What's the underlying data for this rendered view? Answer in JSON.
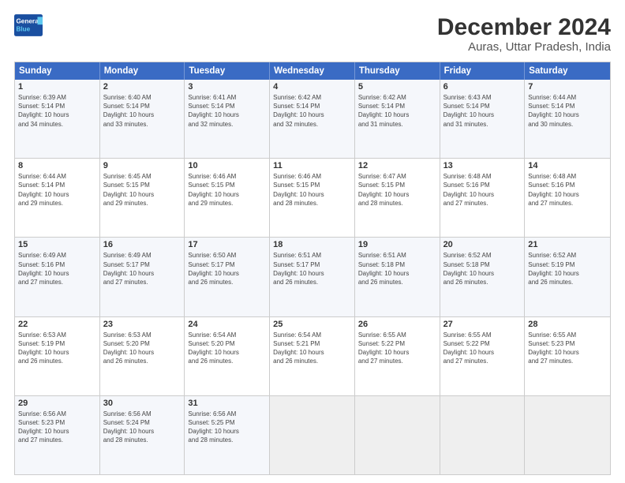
{
  "header": {
    "logo_line1": "General",
    "logo_line2": "Blue",
    "title": "December 2024",
    "subtitle": "Auras, Uttar Pradesh, India"
  },
  "calendar": {
    "days_of_week": [
      "Sunday",
      "Monday",
      "Tuesday",
      "Wednesday",
      "Thursday",
      "Friday",
      "Saturday"
    ],
    "weeks": [
      [
        {
          "day": "",
          "empty": true
        },
        {
          "day": "",
          "empty": true
        },
        {
          "day": "",
          "empty": true
        },
        {
          "day": "",
          "empty": true
        },
        {
          "day": "",
          "empty": true
        },
        {
          "day": "",
          "empty": true
        },
        {
          "day": "",
          "empty": true
        }
      ],
      [
        {
          "day": "1",
          "info": "Sunrise: 6:39 AM\nSunset: 5:14 PM\nDaylight: 10 hours\nand 34 minutes."
        },
        {
          "day": "2",
          "info": "Sunrise: 6:40 AM\nSunset: 5:14 PM\nDaylight: 10 hours\nand 33 minutes."
        },
        {
          "day": "3",
          "info": "Sunrise: 6:41 AM\nSunset: 5:14 PM\nDaylight: 10 hours\nand 32 minutes."
        },
        {
          "day": "4",
          "info": "Sunrise: 6:42 AM\nSunset: 5:14 PM\nDaylight: 10 hours\nand 32 minutes."
        },
        {
          "day": "5",
          "info": "Sunrise: 6:42 AM\nSunset: 5:14 PM\nDaylight: 10 hours\nand 31 minutes."
        },
        {
          "day": "6",
          "info": "Sunrise: 6:43 AM\nSunset: 5:14 PM\nDaylight: 10 hours\nand 31 minutes."
        },
        {
          "day": "7",
          "info": "Sunrise: 6:44 AM\nSunset: 5:14 PM\nDaylight: 10 hours\nand 30 minutes."
        }
      ],
      [
        {
          "day": "8",
          "info": "Sunrise: 6:44 AM\nSunset: 5:14 PM\nDaylight: 10 hours\nand 29 minutes."
        },
        {
          "day": "9",
          "info": "Sunrise: 6:45 AM\nSunset: 5:15 PM\nDaylight: 10 hours\nand 29 minutes."
        },
        {
          "day": "10",
          "info": "Sunrise: 6:46 AM\nSunset: 5:15 PM\nDaylight: 10 hours\nand 29 minutes."
        },
        {
          "day": "11",
          "info": "Sunrise: 6:46 AM\nSunset: 5:15 PM\nDaylight: 10 hours\nand 28 minutes."
        },
        {
          "day": "12",
          "info": "Sunrise: 6:47 AM\nSunset: 5:15 PM\nDaylight: 10 hours\nand 28 minutes."
        },
        {
          "day": "13",
          "info": "Sunrise: 6:48 AM\nSunset: 5:16 PM\nDaylight: 10 hours\nand 27 minutes."
        },
        {
          "day": "14",
          "info": "Sunrise: 6:48 AM\nSunset: 5:16 PM\nDaylight: 10 hours\nand 27 minutes."
        }
      ],
      [
        {
          "day": "15",
          "info": "Sunrise: 6:49 AM\nSunset: 5:16 PM\nDaylight: 10 hours\nand 27 minutes."
        },
        {
          "day": "16",
          "info": "Sunrise: 6:49 AM\nSunset: 5:17 PM\nDaylight: 10 hours\nand 27 minutes."
        },
        {
          "day": "17",
          "info": "Sunrise: 6:50 AM\nSunset: 5:17 PM\nDaylight: 10 hours\nand 26 minutes."
        },
        {
          "day": "18",
          "info": "Sunrise: 6:51 AM\nSunset: 5:17 PM\nDaylight: 10 hours\nand 26 minutes."
        },
        {
          "day": "19",
          "info": "Sunrise: 6:51 AM\nSunset: 5:18 PM\nDaylight: 10 hours\nand 26 minutes."
        },
        {
          "day": "20",
          "info": "Sunrise: 6:52 AM\nSunset: 5:18 PM\nDaylight: 10 hours\nand 26 minutes."
        },
        {
          "day": "21",
          "info": "Sunrise: 6:52 AM\nSunset: 5:19 PM\nDaylight: 10 hours\nand 26 minutes."
        }
      ],
      [
        {
          "day": "22",
          "info": "Sunrise: 6:53 AM\nSunset: 5:19 PM\nDaylight: 10 hours\nand 26 minutes."
        },
        {
          "day": "23",
          "info": "Sunrise: 6:53 AM\nSunset: 5:20 PM\nDaylight: 10 hours\nand 26 minutes."
        },
        {
          "day": "24",
          "info": "Sunrise: 6:54 AM\nSunset: 5:20 PM\nDaylight: 10 hours\nand 26 minutes."
        },
        {
          "day": "25",
          "info": "Sunrise: 6:54 AM\nSunset: 5:21 PM\nDaylight: 10 hours\nand 26 minutes."
        },
        {
          "day": "26",
          "info": "Sunrise: 6:55 AM\nSunset: 5:22 PM\nDaylight: 10 hours\nand 27 minutes."
        },
        {
          "day": "27",
          "info": "Sunrise: 6:55 AM\nSunset: 5:22 PM\nDaylight: 10 hours\nand 27 minutes."
        },
        {
          "day": "28",
          "info": "Sunrise: 6:55 AM\nSunset: 5:23 PM\nDaylight: 10 hours\nand 27 minutes."
        }
      ],
      [
        {
          "day": "29",
          "info": "Sunrise: 6:56 AM\nSunset: 5:23 PM\nDaylight: 10 hours\nand 27 minutes."
        },
        {
          "day": "30",
          "info": "Sunrise: 6:56 AM\nSunset: 5:24 PM\nDaylight: 10 hours\nand 28 minutes."
        },
        {
          "day": "31",
          "info": "Sunrise: 6:56 AM\nSunset: 5:25 PM\nDaylight: 10 hours\nand 28 minutes."
        },
        {
          "day": "",
          "empty": true
        },
        {
          "day": "",
          "empty": true
        },
        {
          "day": "",
          "empty": true
        },
        {
          "day": "",
          "empty": true
        }
      ]
    ]
  }
}
